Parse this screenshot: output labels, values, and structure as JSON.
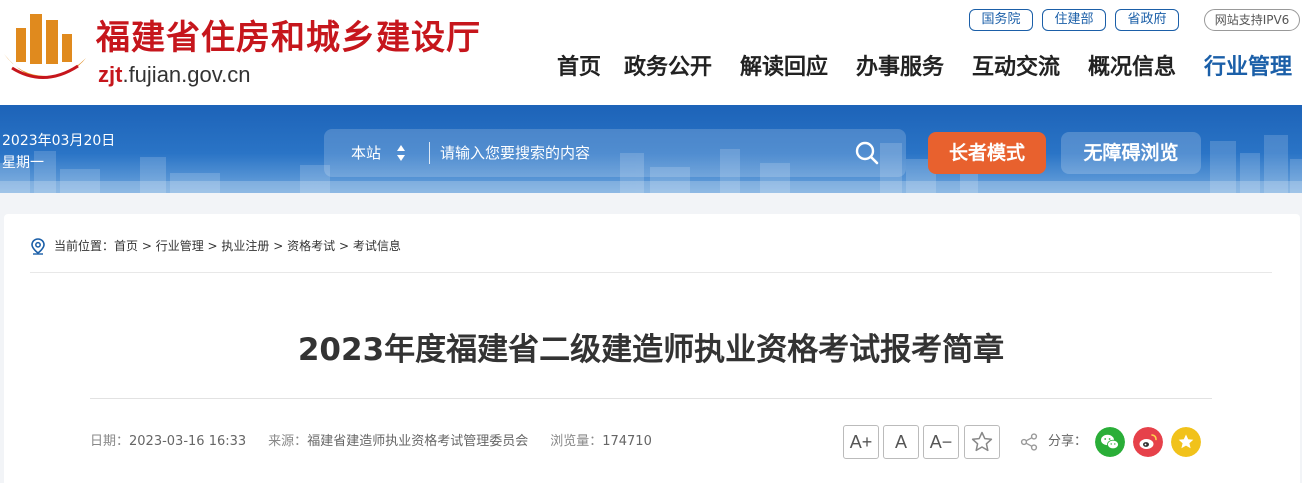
{
  "header": {
    "site_name": "福建省住房和城乡建设厅",
    "domain_prefix": "zjt",
    "domain_suffix": ".fujian.gov.cn",
    "top_links": [
      "国务院",
      "住建部",
      "省政府"
    ],
    "ipv6_label": "网站支持IPV6",
    "nav": [
      "首页",
      "政务公开",
      "解读回应",
      "办事服务",
      "互动交流",
      "概况信息",
      "行业管理"
    ],
    "active_nav": "行业管理",
    "brand_red": "#c6161c",
    "brand_blue": "#1b5fa8"
  },
  "banner": {
    "date": "2023年03月20日",
    "weekday": "星期一",
    "search_scope": "本站",
    "search_placeholder": "请输入您要搜索的内容",
    "elder_mode_label": "长者模式",
    "accessible_label": "无障碍浏览",
    "elder_color": "#e8612e"
  },
  "breadcrumb": {
    "prefix": "当前位置：",
    "items": [
      "首页",
      "行业管理",
      "执业注册",
      "资格考试",
      "考试信息"
    ],
    "separator": " > "
  },
  "article": {
    "title": "2023年度福建省二级建造师执业资格考试报考简章",
    "date_label": "日期：",
    "date": "2023-03-16 16:33",
    "source_label": "来源：",
    "source": "福建省建造师执业资格考试管理委员会",
    "views_label": "浏览量：",
    "views": "174710",
    "font_buttons": [
      "A+",
      "A",
      "A−"
    ],
    "share_label": "分享：",
    "share_icons": [
      "wechat-icon",
      "weibo-icon",
      "favorite-icon"
    ],
    "share_colors": [
      "#2aae38",
      "#e6414a",
      "#f1c21b"
    ]
  }
}
